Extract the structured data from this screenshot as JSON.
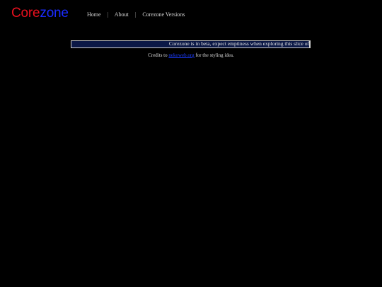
{
  "logo": {
    "part1": "Core",
    "part2": "zone",
    "color_part1": "#e8101e",
    "color_part2": "#1a2bff"
  },
  "nav": {
    "items": [
      {
        "label": "Home"
      },
      {
        "label": "About"
      },
      {
        "label": "Corezone Versions"
      }
    ],
    "separator": "|"
  },
  "banner": {
    "text": "Corezone is in beta, expect emptiness when exploring this slice of"
  },
  "credits": {
    "prefix": "Credits to",
    "link_text": "nekoweb.org",
    "suffix": "for the styling idea."
  },
  "colors": {
    "background": "#000000",
    "banner_fill": "#0b1846",
    "link": "#1b3cff"
  }
}
